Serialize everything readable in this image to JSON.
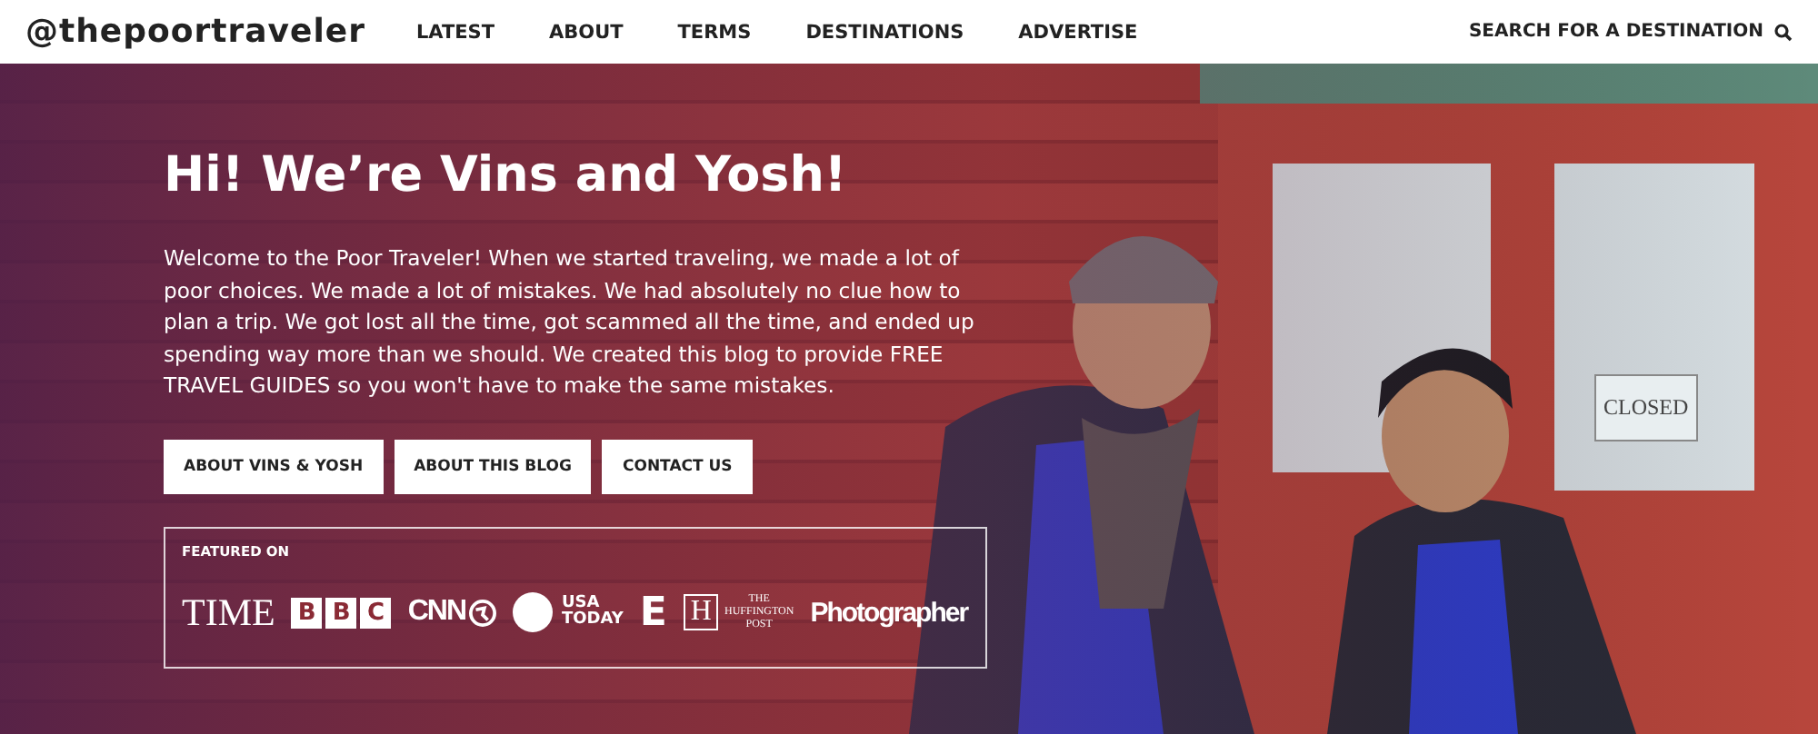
{
  "header": {
    "logo": "@thepoortraveler",
    "nav": [
      {
        "label": "LATEST"
      },
      {
        "label": "ABOUT"
      },
      {
        "label": "TERMS"
      },
      {
        "label": "DESTINATIONS"
      },
      {
        "label": "ADVERTISE"
      }
    ],
    "search": "SEARCH FOR A DESTINATION"
  },
  "hero": {
    "title": "Hi! We’re Vins and Yosh!",
    "intro": "Welcome to the Poor Traveler! When we started traveling, we made a lot of poor choices. We made a lot of mistakes. We had absolutely no clue how to plan a trip. We got lost all the time, got scammed all the time, and ended up spending way more than we should. We created this blog to provide FREE TRAVEL GUIDES so you won't have to make the same mistakes.",
    "buttons": [
      "ABOUT VINS & YOSH",
      "ABOUT THIS BLOG",
      "CONTACT US"
    ],
    "sign": "CLOSED",
    "featured": {
      "label": "FEATURED ON",
      "logos": [
        {
          "kind": "time",
          "text": "TIME"
        },
        {
          "kind": "bbc",
          "letters": [
            "B",
            "B",
            "C"
          ]
        },
        {
          "kind": "cnn",
          "text": "CNN"
        },
        {
          "kind": "usatoday",
          "lines": [
            "USA",
            "TODAY"
          ]
        },
        {
          "kind": "e",
          "text": "E"
        },
        {
          "kind": "huffpost",
          "mark": "H",
          "lines": [
            "THE",
            "HUFFINGTON",
            "POST"
          ]
        },
        {
          "kind": "photographer",
          "text": "Photographer"
        }
      ]
    }
  }
}
